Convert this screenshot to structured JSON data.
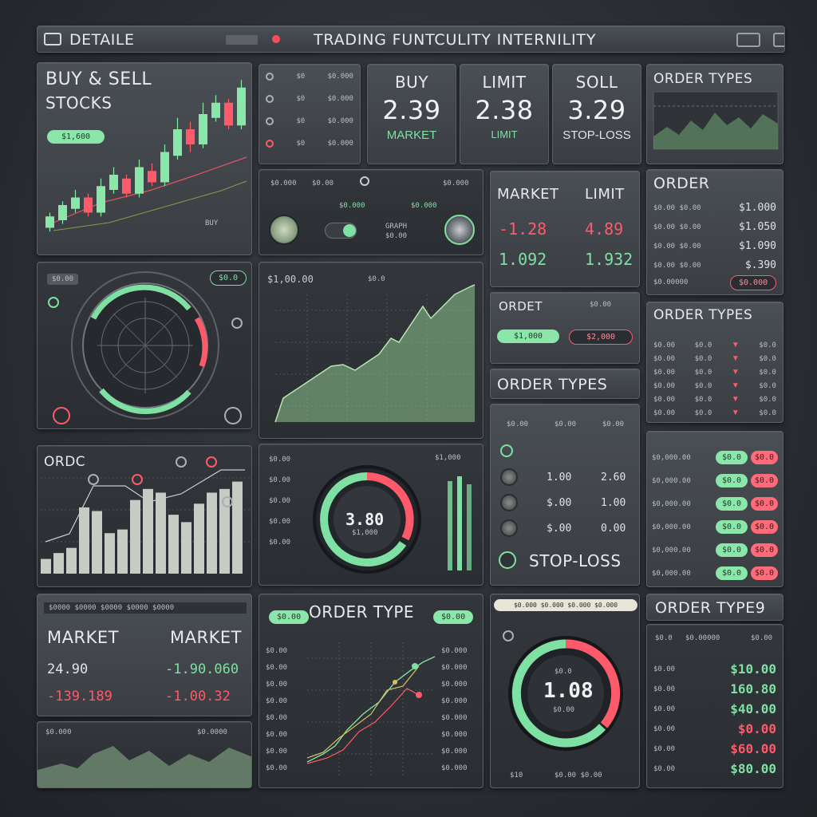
{
  "colors": {
    "accent_green": "#7fe0a3",
    "accent_red": "#ff5a6a",
    "panel": "#3f4348"
  },
  "topbar": {
    "left_label": "DETAILE",
    "title": "TRADING FUNTCULITY INTERNILITY",
    "icon_left": "square-icon",
    "icon_right": [
      "menu-icon",
      "settings-icon"
    ]
  },
  "buy_sell": {
    "title_line1": "BUY & SELL",
    "title_line2": "STOCKS",
    "button": "$1,600",
    "footer": "BUY",
    "candles": [
      {
        "o": 30,
        "c": 45,
        "h": 50,
        "l": 25,
        "up": true
      },
      {
        "o": 40,
        "c": 60,
        "h": 65,
        "l": 35,
        "up": true
      },
      {
        "o": 55,
        "c": 70,
        "h": 80,
        "l": 50,
        "up": true
      },
      {
        "o": 70,
        "c": 50,
        "h": 75,
        "l": 45,
        "up": false
      },
      {
        "o": 50,
        "c": 85,
        "h": 95,
        "l": 45,
        "up": true
      },
      {
        "o": 80,
        "c": 100,
        "h": 110,
        "l": 75,
        "up": true
      },
      {
        "o": 95,
        "c": 75,
        "h": 100,
        "l": 70,
        "up": false
      },
      {
        "o": 75,
        "c": 110,
        "h": 120,
        "l": 70,
        "up": true
      },
      {
        "o": 105,
        "c": 90,
        "h": 115,
        "l": 85,
        "up": false
      },
      {
        "o": 90,
        "c": 130,
        "h": 140,
        "l": 85,
        "up": true
      },
      {
        "o": 125,
        "c": 160,
        "h": 175,
        "l": 120,
        "up": true
      },
      {
        "o": 160,
        "c": 140,
        "h": 170,
        "l": 130,
        "up": false
      },
      {
        "o": 140,
        "c": 180,
        "h": 195,
        "l": 135,
        "up": true
      },
      {
        "o": 175,
        "c": 195,
        "h": 205,
        "l": 170,
        "up": true
      },
      {
        "o": 195,
        "c": 165,
        "h": 200,
        "l": 160,
        "up": false
      },
      {
        "o": 165,
        "c": 215,
        "h": 225,
        "l": 160,
        "up": true
      }
    ]
  },
  "small_list": {
    "rows": [
      {
        "a": "$0",
        "b": "$0.000"
      },
      {
        "a": "$0",
        "b": "$0.000"
      },
      {
        "a": "$0",
        "b": "$0.000"
      },
      {
        "a": "$0",
        "b": "$0.000"
      }
    ]
  },
  "quotes": [
    {
      "label": "BUY",
      "value": "2.39",
      "sub": "MARKET",
      "sub_color": "green"
    },
    {
      "label": "LIMIT",
      "value": "2.38",
      "sub": "LIMIT",
      "sub_color": "green"
    },
    {
      "label": "SOLL",
      "value": "3.29",
      "sub": "STOP-LOSS",
      "sub_color": "light"
    }
  ],
  "order_types_top": {
    "title": "ORDER TYPES"
  },
  "controls": {
    "header_left": "$0.000",
    "header_mid": "$0.00",
    "header_right": "$0.000",
    "mid_label": "GRAPH",
    "mid_value": "$0.00",
    "side_values": [
      "$0.000",
      "$0.000"
    ]
  },
  "market_limit": {
    "left": "MARKET",
    "right": "LIMIT",
    "r1_left": "-1.28",
    "r1_right": "4.89",
    "r2_left": "1.092",
    "r2_right": "1.932"
  },
  "order_list": {
    "title": "ORDER",
    "rows": [
      {
        "label": "$0.00 $0.00",
        "value": "$1.000"
      },
      {
        "label": "$0.00 $0.00",
        "value": "$1.050"
      },
      {
        "label": "$0.00 $0.00",
        "value": "$1.090"
      },
      {
        "label": "$0.00 $0.00",
        "value": "$.390"
      }
    ],
    "footer_label": "$0.00000",
    "footer_btn": "$0.000"
  },
  "radar": {
    "label": "$0.00",
    "badge": "$0.0"
  },
  "area_chart": {
    "title": "$1,00.00",
    "tag": "$0.0"
  },
  "order_set": {
    "title": "ORDET",
    "value": "$0.00",
    "btn_green": "$1,000",
    "btn_red": "$2,000"
  },
  "order_types_mid": {
    "title": "ORDER TYPES"
  },
  "order_types_right": {
    "title": "ORDER TYPES",
    "rows": [
      {
        "a": "$0.00",
        "b": "$0.0",
        "c": "$0.0"
      },
      {
        "a": "$0.00",
        "b": "$0.0",
        "c": "$0.0"
      },
      {
        "a": "$0.00",
        "b": "$0.0",
        "c": "$0.0"
      },
      {
        "a": "$0.00",
        "b": "$0.0",
        "c": "$0.0"
      },
      {
        "a": "$0.00",
        "b": "$0.0",
        "c": "$0.0"
      },
      {
        "a": "$0.00",
        "b": "$0.0",
        "c": "$0.0"
      }
    ]
  },
  "bars_panel": {
    "title": "ORDC",
    "bars": [
      20,
      28,
      35,
      90,
      85,
      55,
      60,
      100,
      115,
      110,
      80,
      70,
      95,
      110,
      115,
      125
    ]
  },
  "gauge1": {
    "value": "3.80",
    "sub": "$1,000",
    "left_labels": [
      "$0.00",
      "$0.00",
      "$0.00",
      "$0.00",
      "$0.00"
    ],
    "right_label": "$1,000"
  },
  "stop_loss": {
    "header": [
      "$0.00",
      "$0.00",
      "$0.00"
    ],
    "rows": [
      {
        "mid": "1.00",
        "right": "2.60"
      },
      {
        "mid": "$.00",
        "right": "1.00"
      },
      {
        "mid": "$.00",
        "right": "0.00"
      }
    ],
    "footer": "STOP-LOSS"
  },
  "buttons_list": {
    "rows": [
      {
        "label": "$0,000.00",
        "g": "$0.0",
        "r": "$0.0"
      },
      {
        "label": "$0,000.00",
        "g": "$0.0",
        "r": "$0.0"
      },
      {
        "label": "$0,000.00",
        "g": "$0.0",
        "r": "$0.0"
      },
      {
        "label": "$0,000.00",
        "g": "$0.0",
        "r": "$0.0"
      },
      {
        "label": "$0,000.00",
        "g": "$0.0",
        "r": "$0.0"
      },
      {
        "label": "$0,000.00",
        "g": "$0.0",
        "r": "$0.0"
      }
    ]
  },
  "market_bottom": {
    "top": "$0000 $0000 $0000 $0000 $0000",
    "left": "MARKET",
    "right": "MARKET",
    "r1_left": "24.90",
    "r1_right": "-1.90.060",
    "r2_left": "-139.189",
    "r2_right": "-1.00.32"
  },
  "mini_area": {
    "left": "$0.000",
    "right": "$0.0000"
  },
  "order_type_chart": {
    "title": "ORDER TYPE",
    "left_btn": "$0.00",
    "right_btn": "$0.00",
    "left_labels": [
      "$0.00",
      "$0.00",
      "$0.00",
      "$0.00",
      "$0.00",
      "$0.00",
      "$0.00",
      "$0.00"
    ],
    "right_labels": [
      "$0.000",
      "$0.000",
      "$0.000",
      "$0.000",
      "$0.000",
      "$0.000",
      "$0.000",
      "$0.000"
    ]
  },
  "gauge2": {
    "header": "$0.000 $0.000 $0.000 $0.000",
    "value": "1.08",
    "top": "$0.0",
    "sub": "$0.00",
    "footer_left": "$10",
    "footer_right": "$0.00 $0.00"
  },
  "order_type_values": {
    "title": "ORDER TYPE9",
    "header": [
      "$0.0",
      "$0.00000",
      "$0.00"
    ],
    "rows": [
      {
        "label": "$0.00",
        "value": "$10.00",
        "color": "green"
      },
      {
        "label": "$0.00",
        "value": "160.80",
        "color": "green"
      },
      {
        "label": "$0.00",
        "value": "$40.00",
        "color": "green"
      },
      {
        "label": "$0.00",
        "value": "$0.00",
        "color": "red"
      },
      {
        "label": "$0.00",
        "value": "$60.00",
        "color": "red"
      },
      {
        "label": "$0.00",
        "value": "$80.00",
        "color": "green"
      }
    ]
  }
}
